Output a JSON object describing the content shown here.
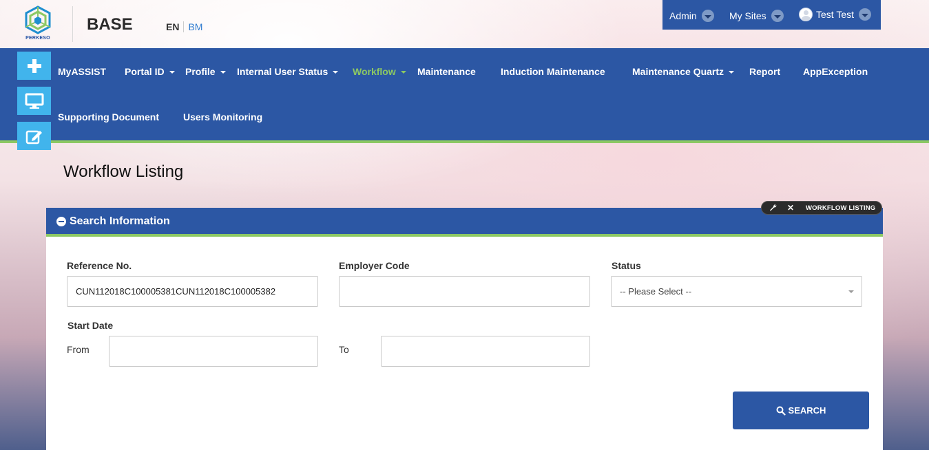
{
  "header": {
    "logo_text": "PERKESO",
    "app_title": "BASE",
    "languages": [
      "EN",
      "BM"
    ]
  },
  "user_bar": {
    "admin_label": "Admin",
    "sites_label": "My Sites",
    "user_name": "Test Test"
  },
  "nav": {
    "items": [
      {
        "label": "MyASSIST"
      },
      {
        "label": "Portal ID"
      },
      {
        "label": "Profile"
      },
      {
        "label": "Internal User Status"
      },
      {
        "label": "Workflow"
      },
      {
        "label": "Maintenance"
      },
      {
        "label": "Induction Maintenance"
      },
      {
        "label": "Maintenance Quartz"
      },
      {
        "label": "Report"
      },
      {
        "label": "AppException"
      },
      {
        "label": "Supporting Document"
      },
      {
        "label": "Users Monitoring"
      }
    ],
    "active": "Workflow",
    "side_icons": [
      "plus-icon",
      "monitor-icon",
      "edit-icon"
    ]
  },
  "page": {
    "title": "Workflow Listing"
  },
  "panel": {
    "title": "Search Information",
    "tools_label": "WORKFLOW LISTING",
    "fields": {
      "reference_label": "Reference No.",
      "reference_value": "CUN112018C100005381CUN112018C100005382",
      "employer_label": "Employer Code",
      "employer_value": "",
      "status_label": "Status",
      "status_value": "-- Please Select --",
      "start_date_label": "Start Date",
      "from_label": "From",
      "from_value": "",
      "to_label": "To",
      "to_value": ""
    },
    "search_button": "SEARCH"
  },
  "colors": {
    "primary": "#2c57a4",
    "accent_green": "#8cc863",
    "side_button": "#41b4ec"
  }
}
